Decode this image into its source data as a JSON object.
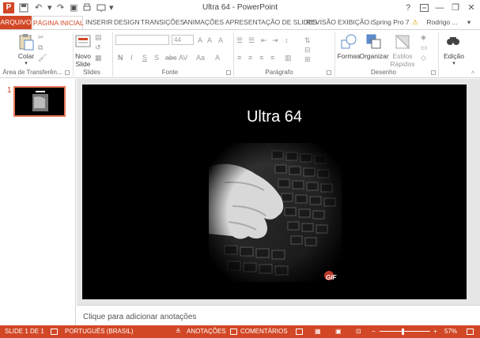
{
  "window": {
    "title": "Ultra 64 - PowerPoint",
    "help": "?",
    "min": "—",
    "restore": "❐",
    "close": "✕",
    "app_icon": "P"
  },
  "qat": {
    "save": "💾",
    "undo": "↶",
    "redo": "↷",
    "start": "▣",
    "customize": "▾"
  },
  "tabs": [
    {
      "label": "ARQUIVO"
    },
    {
      "label": "PÁGINA INICIAL"
    },
    {
      "label": "INSERIR"
    },
    {
      "label": "DESIGN"
    },
    {
      "label": "TRANSIÇÕES"
    },
    {
      "label": "ANIMAÇÕES"
    },
    {
      "label": "APRESENTAÇÃO DE SLIDES"
    },
    {
      "label": "REVISÃO"
    },
    {
      "label": "EXIBIÇÃO"
    },
    {
      "label": "iSpring Pro 7"
    }
  ],
  "user": {
    "name": "Rodrigo ...",
    "warning_icon": "⚠"
  },
  "ribbon": {
    "clipboard": {
      "paste": "Colar",
      "group": "Área de Transferên..."
    },
    "slides": {
      "new_slide_1": "Novo",
      "new_slide_2": "Slide",
      "group": "Slides"
    },
    "font": {
      "size": "44",
      "bold": "N",
      "italic": "I",
      "underline": "S",
      "strike": "S",
      "spacing": "AV",
      "case": "Aa",
      "group": "Fonte"
    },
    "paragraph": {
      "group": "Parágrafo"
    },
    "drawing": {
      "shapes": "Formas",
      "arrange": "Organizar",
      "styles_1": "Estilos",
      "styles_2": "Rápidos",
      "group": "Desenho"
    },
    "editing": {
      "label": "Edição"
    }
  },
  "slide_panel": {
    "number": "1"
  },
  "slide": {
    "title": "Ultra 64",
    "gif_badge": "GIF"
  },
  "notes": {
    "placeholder": "Clique para adicionar anotações"
  },
  "status": {
    "slide": "SLIDE 1 DE 1",
    "language": "PORTUGUÊS (BRASIL)",
    "notes": "ANOTAÇÕES",
    "comments": "COMENTÁRIOS",
    "zoom": "57%",
    "zoom_minus": "−",
    "zoom_plus": "+"
  },
  "colors": {
    "accent": "#d24726",
    "slide_bg": "#000000"
  }
}
